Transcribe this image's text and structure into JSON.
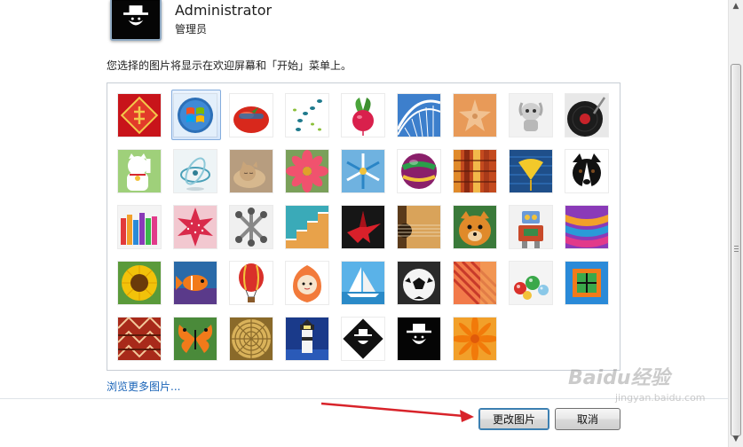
{
  "user": {
    "name": "Administrator",
    "role": "管理员"
  },
  "hint": "您选择的图片将显示在欢迎屏幕和「开始」菜单上。",
  "browse_link": "浏览更多图片...",
  "buttons": {
    "change": "更改图片",
    "cancel": "取消"
  },
  "watermark": {
    "logo": "Baidu经验",
    "url": "jingyan.baidu.com"
  },
  "selected_picture": "windows-logo-picture",
  "pictures": [
    [
      "fu-picture",
      "windows-logo-picture",
      "tomato-picture",
      "seeds-picture",
      "radish-picture",
      "roller-coaster-picture",
      "starfish-picture",
      "robot-toy-picture",
      "vinyl-record-picture"
    ],
    [
      "lucky-cat-picture",
      "gyroscope-picture",
      "kitten-picture",
      "pink-flower-picture",
      "pinwheel-picture",
      "ball-picture",
      "fabric-picture",
      "ginkgo-leaf-picture",
      "dog-picture"
    ],
    [
      "crayons-picture",
      "paper-star-picture",
      "jacks-picture",
      "stairs-picture",
      "origami-crane-picture",
      "guitar-picture",
      "puppy-picture",
      "tin-robot-picture",
      "colorful-scarf-picture"
    ],
    [
      "sunflower-picture",
      "fish-picture",
      "hot-air-balloon-picture",
      "doll-picture",
      "sailboat-picture",
      "soccer-ball-picture",
      "fabric-stripes-picture",
      "marbles-picture",
      "green-frame-picture"
    ],
    [
      "woven-pattern-picture",
      "butterfly-picture",
      "basket-weave-picture",
      "lighthouse-picture",
      "diamond-logo-picture",
      "hat-face-picture",
      "orange-flower-picture"
    ]
  ]
}
